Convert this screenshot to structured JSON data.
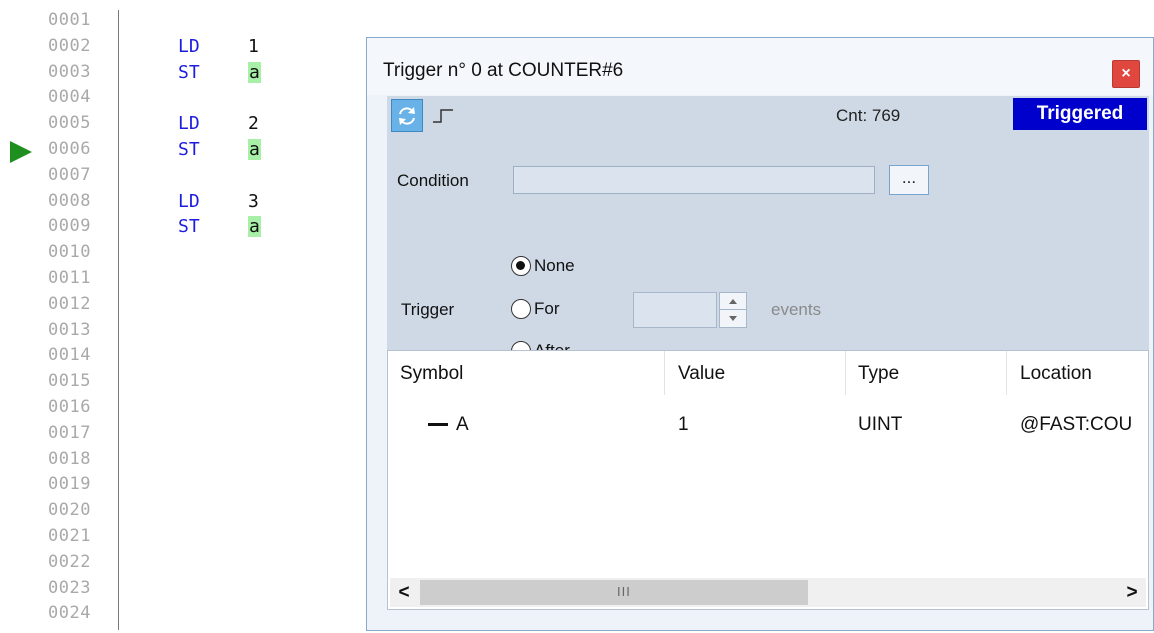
{
  "editor": {
    "line_numbers": [
      "0001",
      "0002",
      "0003",
      "0004",
      "0005",
      "0006",
      "0007",
      "0008",
      "0009",
      "0010",
      "0011",
      "0012",
      "0013",
      "0014",
      "0015",
      "0016",
      "0017",
      "0018",
      "0019",
      "0020",
      "0021",
      "0022",
      "0023",
      "0024"
    ],
    "current_line": "0006",
    "code": [
      {
        "line": "0002",
        "op": "LD",
        "arg": "1",
        "arg_is_var": false
      },
      {
        "line": "0003",
        "op": "ST",
        "arg": "a",
        "arg_is_var": true
      },
      {
        "line": "0005",
        "op": "LD",
        "arg": "2",
        "arg_is_var": false
      },
      {
        "line": "0006",
        "op": "ST",
        "arg": "a",
        "arg_is_var": true
      },
      {
        "line": "0008",
        "op": "LD",
        "arg": "3",
        "arg_is_var": false
      },
      {
        "line": "0009",
        "op": "ST",
        "arg": "a",
        "arg_is_var": true
      }
    ],
    "colors": {
      "keyword": "#1d1de0",
      "var_highlight": "#a8f0a8",
      "line_number": "#a9a9a9",
      "exec_arrow": "#1f8f1f"
    }
  },
  "trigger_window": {
    "title": "Trigger n° 0 at COUNTER#6",
    "close_label": "×",
    "toolbar": {
      "refresh_icon": "refresh-icon",
      "edge_icon": "rising-edge-icon",
      "count_text": "Cnt: 769",
      "status": "Triggered",
      "status_color": "#0000cc"
    },
    "condition": {
      "label": "Condition",
      "value": "",
      "browse_label": "..."
    },
    "trigger": {
      "label": "Trigger",
      "options": [
        {
          "label": "None",
          "selected": true
        },
        {
          "label": "For",
          "selected": false
        },
        {
          "label": "After",
          "selected": false
        }
      ],
      "count_value": "",
      "unit_label": "events"
    },
    "table": {
      "columns": [
        "Symbol",
        "Value",
        "Type",
        "Location"
      ],
      "rows": [
        {
          "symbol": "A",
          "value": "1",
          "type": "UINT",
          "location": "@FAST:COU"
        }
      ],
      "scroll_left": "<",
      "scroll_right": ">",
      "thumb_grip": "III"
    }
  }
}
